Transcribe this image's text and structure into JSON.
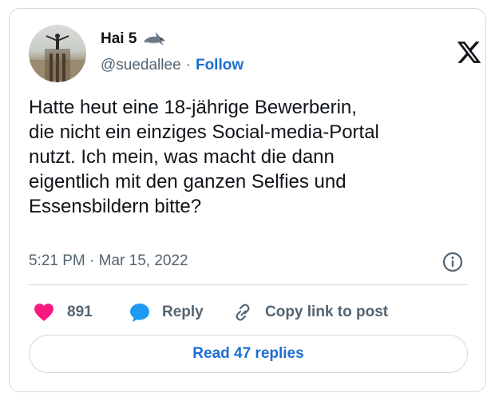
{
  "author": {
    "display_name": "Hai 5",
    "handle": "@suedallee",
    "follow_label": "Follow",
    "separator": "·"
  },
  "tweet": {
    "text": "Hatte heut eine 18-jährige Bewerberin,\ndie nicht ein einziges Social-media-Portal\nnutzt. Ich mein, was macht die dann\neigentlich mit den ganzen Selfies und\nEssensbildern bitte?",
    "timestamp": "5:21 PM · Mar 15, 2022"
  },
  "actions": {
    "like_count": "891",
    "reply_label": "Reply",
    "copy_label": "Copy link to post"
  },
  "read_replies_label": "Read 47 replies",
  "icons": {
    "logo": "x-logo-icon",
    "badge": "shark-icon",
    "info": "info-icon",
    "like": "heart-icon",
    "reply": "speech-bubble-icon",
    "copy": "link-icon"
  },
  "colors": {
    "link_blue": "#1d6fd1",
    "heart_pink": "#f91880",
    "reply_blue": "#1d9bf0",
    "muted_text": "#536471",
    "border": "#cfd9de"
  }
}
